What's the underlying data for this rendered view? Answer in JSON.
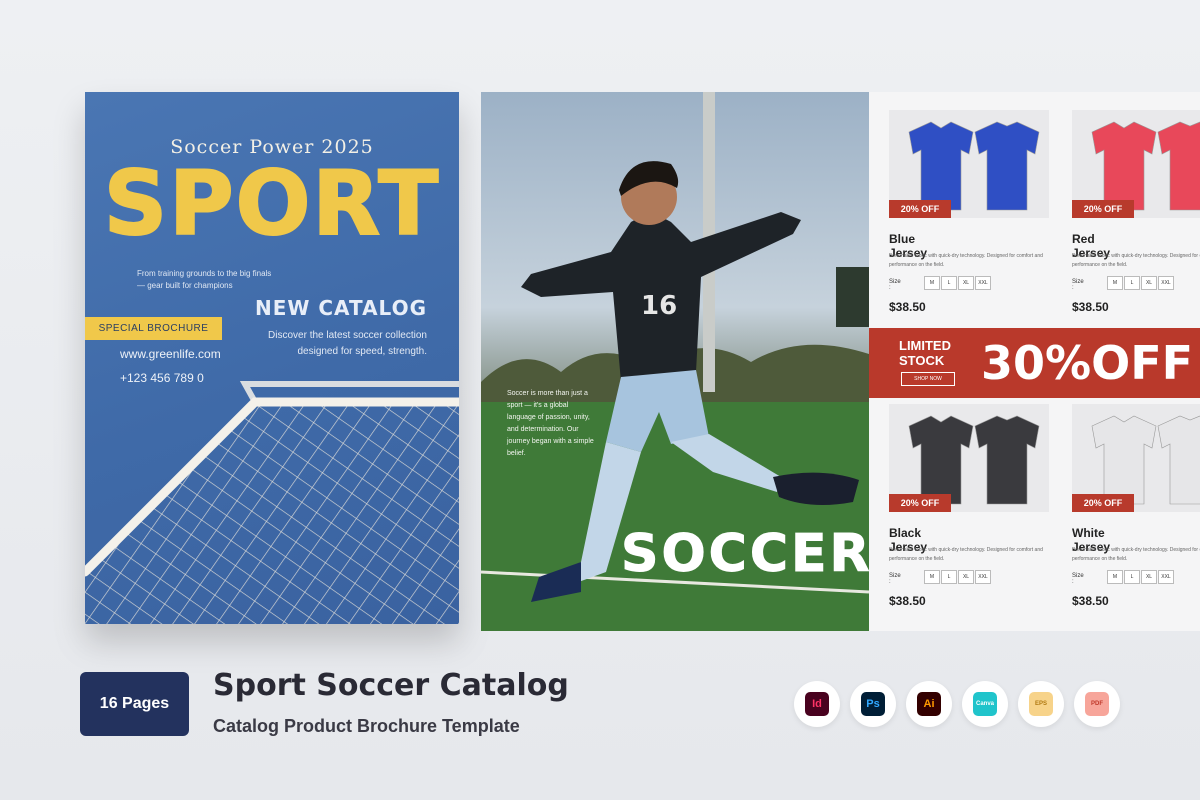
{
  "cover": {
    "kicker": "Soccer Power 2025",
    "title": "SPORT",
    "tagline": "From training grounds to the big finals — gear built for champions",
    "new_catalog": "NEW CATALOG",
    "discover": "Discover the latest soccer collection designed for speed, strength.",
    "special": "SPECIAL BROCHURE",
    "website": "www.greenlife.com",
    "phone": "+123 456 789 0"
  },
  "photo_page": {
    "story": "Soccer is more than just a sport — it's a global language of passion, unity, and determination. Our journey began with a simple belief.",
    "headline": "SOCCER",
    "jersey_number": "16"
  },
  "products": {
    "items": [
      {
        "name": "Blue Jersey",
        "badge": "20% OFF",
        "desc": "Breathable fabric with quick-dry technology. Designed for comfort and performance on the field.",
        "price": "$38.50",
        "color": "#2f4fc4"
      },
      {
        "name": "Red Jersey",
        "badge": "20% OFF",
        "desc": "Breathable fabric with quick-dry technology. Designed for comfort and performance on the field.",
        "price": "$38.50",
        "color": "#e8485a"
      },
      {
        "name": "Black Jersey",
        "badge": "20% OFF",
        "desc": "Breathable fabric with quick-dry technology. Designed for comfort and performance on the field.",
        "price": "$38.50",
        "color": "#3a3a3e"
      },
      {
        "name": "White Jersey",
        "badge": "20% OFF",
        "desc": "Breathable fabric with quick-dry technology. Designed for comfort and performance on the field.",
        "price": "$38.50",
        "color": "#e6e6e8"
      }
    ],
    "size_label": "Size :",
    "sizes": [
      "M",
      "L",
      "XL",
      "XXL"
    ],
    "promo": {
      "limited": "LIMITED STOCK",
      "shop": "SHOP NOW",
      "off": "30%OFF"
    }
  },
  "footer": {
    "pages": "16 Pages",
    "title": "Sport Soccer Catalog",
    "subtitle": "Catalog Product Brochure Template",
    "formats": [
      {
        "icon": "indesign-icon",
        "label": "Id",
        "color": "#49021f",
        "fg": "#ff3366"
      },
      {
        "icon": "photoshop-icon",
        "label": "Ps",
        "color": "#001e36",
        "fg": "#31a8ff"
      },
      {
        "icon": "illustrator-icon",
        "label": "Ai",
        "color": "#330000",
        "fg": "#ff9a00"
      },
      {
        "icon": "canva-icon",
        "label": "Canva",
        "color": "#20c4cb",
        "fg": "#ffffff"
      },
      {
        "icon": "eps-file-icon",
        "label": "EPS",
        "color": "#f7d38a",
        "fg": "#b07a12"
      },
      {
        "icon": "pdf-file-icon",
        "label": "PDF",
        "color": "#f7a59a",
        "fg": "#c0392b"
      }
    ]
  },
  "colors": {
    "cover_blue": "#4a76b3",
    "accent_yellow": "#f0c84a",
    "promo_red": "#b9392b",
    "badge_navy": "#23325e"
  }
}
